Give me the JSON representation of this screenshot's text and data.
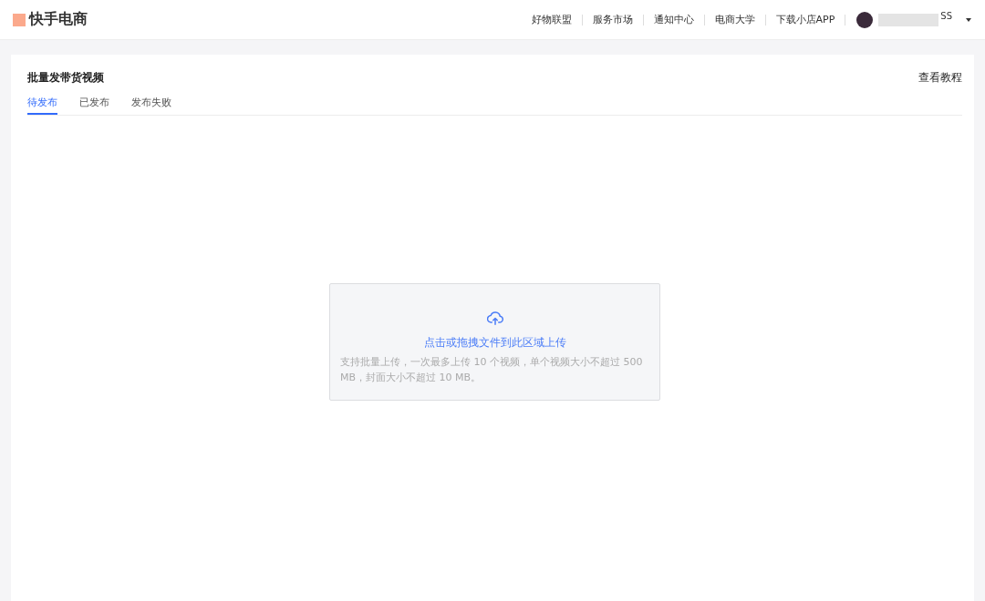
{
  "header": {
    "logo": "快手电商",
    "nav": [
      "好物联盟",
      "服务市场",
      "通知中心",
      "电商大学",
      "下载小店APP"
    ],
    "user": {
      "name": "SS"
    }
  },
  "page": {
    "title": "批量发带货视频",
    "help_link": "查看教程",
    "tabs": [
      {
        "label": "待发布",
        "selected": true
      },
      {
        "label": "已发布",
        "selected": false
      },
      {
        "label": "发布失败",
        "selected": false
      }
    ],
    "upload": {
      "prompt": "点击或拖拽文件到此区域上传",
      "hint": "支持批量上传，一次最多上传 10 个视频，单个视频大小不超过 500 MB，封面大小不超过 10 MB。"
    }
  }
}
